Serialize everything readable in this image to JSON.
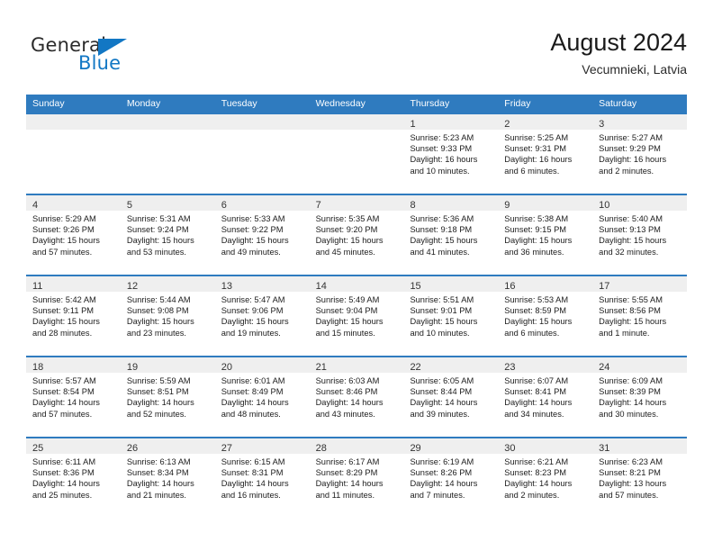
{
  "brand": {
    "name_part1": "General",
    "name_part2": "Blue",
    "accent_color": "#1277c4"
  },
  "header": {
    "title": "August 2024",
    "subtitle": "Vecumnieki, Latvia",
    "header_bg_color": "#2f7bbf",
    "day_band_color": "#efefef"
  },
  "weekdays": [
    {
      "label": "Sunday"
    },
    {
      "label": "Monday"
    },
    {
      "label": "Tuesday"
    },
    {
      "label": "Wednesday"
    },
    {
      "label": "Thursday"
    },
    {
      "label": "Friday"
    },
    {
      "label": "Saturday"
    }
  ],
  "weeks": [
    {
      "days": [
        {
          "date": "",
          "empty": true,
          "sunrise": "",
          "sunset": "",
          "daylight_line1": "",
          "daylight_line2": ""
        },
        {
          "date": "",
          "empty": true,
          "sunrise": "",
          "sunset": "",
          "daylight_line1": "",
          "daylight_line2": ""
        },
        {
          "date": "",
          "empty": true,
          "sunrise": "",
          "sunset": "",
          "daylight_line1": "",
          "daylight_line2": ""
        },
        {
          "date": "",
          "empty": true,
          "sunrise": "",
          "sunset": "",
          "daylight_line1": "",
          "daylight_line2": ""
        },
        {
          "date": "1",
          "empty": false,
          "sunrise": "Sunrise: 5:23 AM",
          "sunset": "Sunset: 9:33 PM",
          "daylight_line1": "Daylight: 16 hours",
          "daylight_line2": "and 10 minutes."
        },
        {
          "date": "2",
          "empty": false,
          "sunrise": "Sunrise: 5:25 AM",
          "sunset": "Sunset: 9:31 PM",
          "daylight_line1": "Daylight: 16 hours",
          "daylight_line2": "and 6 minutes."
        },
        {
          "date": "3",
          "empty": false,
          "sunrise": "Sunrise: 5:27 AM",
          "sunset": "Sunset: 9:29 PM",
          "daylight_line1": "Daylight: 16 hours",
          "daylight_line2": "and 2 minutes."
        }
      ]
    },
    {
      "days": [
        {
          "date": "4",
          "empty": false,
          "sunrise": "Sunrise: 5:29 AM",
          "sunset": "Sunset: 9:26 PM",
          "daylight_line1": "Daylight: 15 hours",
          "daylight_line2": "and 57 minutes."
        },
        {
          "date": "5",
          "empty": false,
          "sunrise": "Sunrise: 5:31 AM",
          "sunset": "Sunset: 9:24 PM",
          "daylight_line1": "Daylight: 15 hours",
          "daylight_line2": "and 53 minutes."
        },
        {
          "date": "6",
          "empty": false,
          "sunrise": "Sunrise: 5:33 AM",
          "sunset": "Sunset: 9:22 PM",
          "daylight_line1": "Daylight: 15 hours",
          "daylight_line2": "and 49 minutes."
        },
        {
          "date": "7",
          "empty": false,
          "sunrise": "Sunrise: 5:35 AM",
          "sunset": "Sunset: 9:20 PM",
          "daylight_line1": "Daylight: 15 hours",
          "daylight_line2": "and 45 minutes."
        },
        {
          "date": "8",
          "empty": false,
          "sunrise": "Sunrise: 5:36 AM",
          "sunset": "Sunset: 9:18 PM",
          "daylight_line1": "Daylight: 15 hours",
          "daylight_line2": "and 41 minutes."
        },
        {
          "date": "9",
          "empty": false,
          "sunrise": "Sunrise: 5:38 AM",
          "sunset": "Sunset: 9:15 PM",
          "daylight_line1": "Daylight: 15 hours",
          "daylight_line2": "and 36 minutes."
        },
        {
          "date": "10",
          "empty": false,
          "sunrise": "Sunrise: 5:40 AM",
          "sunset": "Sunset: 9:13 PM",
          "daylight_line1": "Daylight: 15 hours",
          "daylight_line2": "and 32 minutes."
        }
      ]
    },
    {
      "days": [
        {
          "date": "11",
          "empty": false,
          "sunrise": "Sunrise: 5:42 AM",
          "sunset": "Sunset: 9:11 PM",
          "daylight_line1": "Daylight: 15 hours",
          "daylight_line2": "and 28 minutes."
        },
        {
          "date": "12",
          "empty": false,
          "sunrise": "Sunrise: 5:44 AM",
          "sunset": "Sunset: 9:08 PM",
          "daylight_line1": "Daylight: 15 hours",
          "daylight_line2": "and 23 minutes."
        },
        {
          "date": "13",
          "empty": false,
          "sunrise": "Sunrise: 5:47 AM",
          "sunset": "Sunset: 9:06 PM",
          "daylight_line1": "Daylight: 15 hours",
          "daylight_line2": "and 19 minutes."
        },
        {
          "date": "14",
          "empty": false,
          "sunrise": "Sunrise: 5:49 AM",
          "sunset": "Sunset: 9:04 PM",
          "daylight_line1": "Daylight: 15 hours",
          "daylight_line2": "and 15 minutes."
        },
        {
          "date": "15",
          "empty": false,
          "sunrise": "Sunrise: 5:51 AM",
          "sunset": "Sunset: 9:01 PM",
          "daylight_line1": "Daylight: 15 hours",
          "daylight_line2": "and 10 minutes."
        },
        {
          "date": "16",
          "empty": false,
          "sunrise": "Sunrise: 5:53 AM",
          "sunset": "Sunset: 8:59 PM",
          "daylight_line1": "Daylight: 15 hours",
          "daylight_line2": "and 6 minutes."
        },
        {
          "date": "17",
          "empty": false,
          "sunrise": "Sunrise: 5:55 AM",
          "sunset": "Sunset: 8:56 PM",
          "daylight_line1": "Daylight: 15 hours",
          "daylight_line2": "and 1 minute."
        }
      ]
    },
    {
      "days": [
        {
          "date": "18",
          "empty": false,
          "sunrise": "Sunrise: 5:57 AM",
          "sunset": "Sunset: 8:54 PM",
          "daylight_line1": "Daylight: 14 hours",
          "daylight_line2": "and 57 minutes."
        },
        {
          "date": "19",
          "empty": false,
          "sunrise": "Sunrise: 5:59 AM",
          "sunset": "Sunset: 8:51 PM",
          "daylight_line1": "Daylight: 14 hours",
          "daylight_line2": "and 52 minutes."
        },
        {
          "date": "20",
          "empty": false,
          "sunrise": "Sunrise: 6:01 AM",
          "sunset": "Sunset: 8:49 PM",
          "daylight_line1": "Daylight: 14 hours",
          "daylight_line2": "and 48 minutes."
        },
        {
          "date": "21",
          "empty": false,
          "sunrise": "Sunrise: 6:03 AM",
          "sunset": "Sunset: 8:46 PM",
          "daylight_line1": "Daylight: 14 hours",
          "daylight_line2": "and 43 minutes."
        },
        {
          "date": "22",
          "empty": false,
          "sunrise": "Sunrise: 6:05 AM",
          "sunset": "Sunset: 8:44 PM",
          "daylight_line1": "Daylight: 14 hours",
          "daylight_line2": "and 39 minutes."
        },
        {
          "date": "23",
          "empty": false,
          "sunrise": "Sunrise: 6:07 AM",
          "sunset": "Sunset: 8:41 PM",
          "daylight_line1": "Daylight: 14 hours",
          "daylight_line2": "and 34 minutes."
        },
        {
          "date": "24",
          "empty": false,
          "sunrise": "Sunrise: 6:09 AM",
          "sunset": "Sunset: 8:39 PM",
          "daylight_line1": "Daylight: 14 hours",
          "daylight_line2": "and 30 minutes."
        }
      ]
    },
    {
      "days": [
        {
          "date": "25",
          "empty": false,
          "sunrise": "Sunrise: 6:11 AM",
          "sunset": "Sunset: 8:36 PM",
          "daylight_line1": "Daylight: 14 hours",
          "daylight_line2": "and 25 minutes."
        },
        {
          "date": "26",
          "empty": false,
          "sunrise": "Sunrise: 6:13 AM",
          "sunset": "Sunset: 8:34 PM",
          "daylight_line1": "Daylight: 14 hours",
          "daylight_line2": "and 21 minutes."
        },
        {
          "date": "27",
          "empty": false,
          "sunrise": "Sunrise: 6:15 AM",
          "sunset": "Sunset: 8:31 PM",
          "daylight_line1": "Daylight: 14 hours",
          "daylight_line2": "and 16 minutes."
        },
        {
          "date": "28",
          "empty": false,
          "sunrise": "Sunrise: 6:17 AM",
          "sunset": "Sunset: 8:29 PM",
          "daylight_line1": "Daylight: 14 hours",
          "daylight_line2": "and 11 minutes."
        },
        {
          "date": "29",
          "empty": false,
          "sunrise": "Sunrise: 6:19 AM",
          "sunset": "Sunset: 8:26 PM",
          "daylight_line1": "Daylight: 14 hours",
          "daylight_line2": "and 7 minutes."
        },
        {
          "date": "30",
          "empty": false,
          "sunrise": "Sunrise: 6:21 AM",
          "sunset": "Sunset: 8:23 PM",
          "daylight_line1": "Daylight: 14 hours",
          "daylight_line2": "and 2 minutes."
        },
        {
          "date": "31",
          "empty": false,
          "sunrise": "Sunrise: 6:23 AM",
          "sunset": "Sunset: 8:21 PM",
          "daylight_line1": "Daylight: 13 hours",
          "daylight_line2": "and 57 minutes."
        }
      ]
    }
  ]
}
